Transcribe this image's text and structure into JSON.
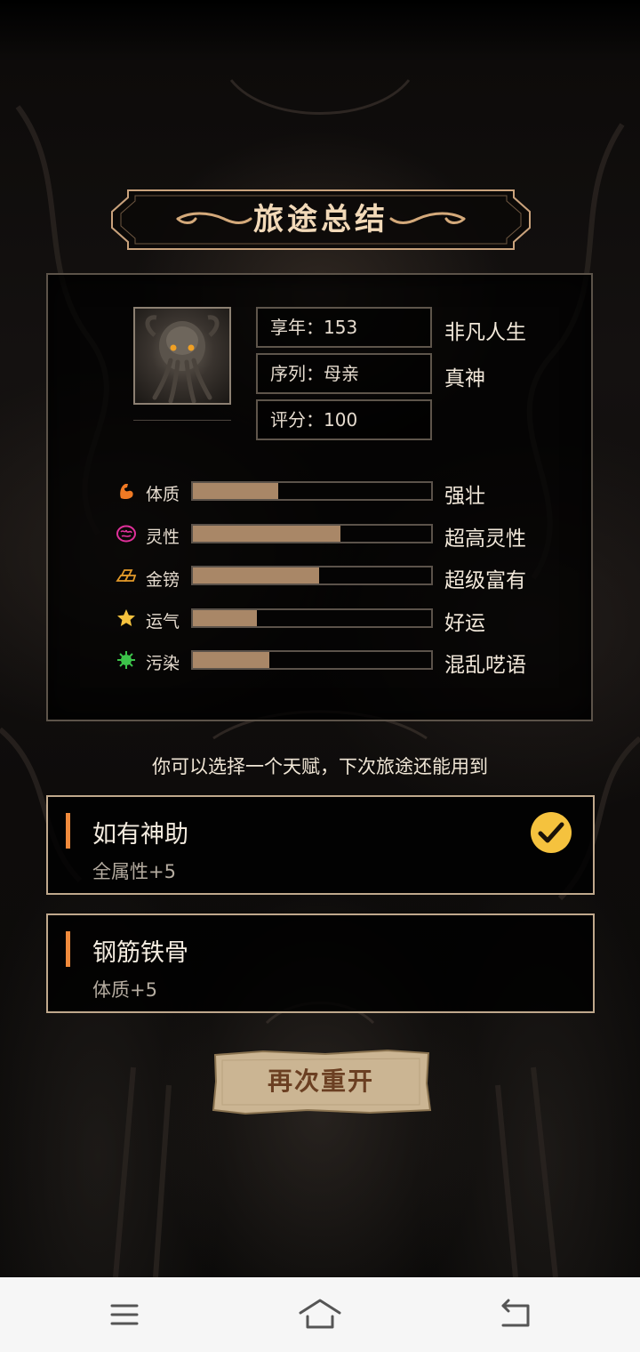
{
  "title": "旅途总结",
  "info": {
    "age": "享年：153",
    "age_desc": "非凡人生",
    "sequence": "序列：母亲",
    "sequence_desc": "真神",
    "score": "评分：100"
  },
  "stats": [
    {
      "icon": "muscle-icon",
      "label": "体质",
      "level": 0.36,
      "desc": "强壮",
      "color": "#f07a24"
    },
    {
      "icon": "brain-icon",
      "label": "灵性",
      "level": 0.62,
      "desc": "超高灵性",
      "color": "#e0309a"
    },
    {
      "icon": "gold-bars-icon",
      "label": "金镑",
      "level": 0.53,
      "desc": "超级富有",
      "color": "#e39a2a"
    },
    {
      "icon": "star-icon",
      "label": "运气",
      "level": 0.27,
      "desc": "好运",
      "color": "#f5c23e"
    },
    {
      "icon": "virus-icon",
      "label": "污染",
      "level": 0.32,
      "desc": "混乱呓语",
      "color": "#3cc24a"
    }
  ],
  "prompt": "你可以选择一个天赋，下次旅途还能用到",
  "talents": [
    {
      "name": "如有神助",
      "desc": "全属性+5",
      "selected": true
    },
    {
      "name": "钢筋铁骨",
      "desc": "体质+5",
      "selected": false
    }
  ],
  "restart_label": "再次重开",
  "nav": [
    "menu-icon",
    "home-icon",
    "back-icon"
  ]
}
